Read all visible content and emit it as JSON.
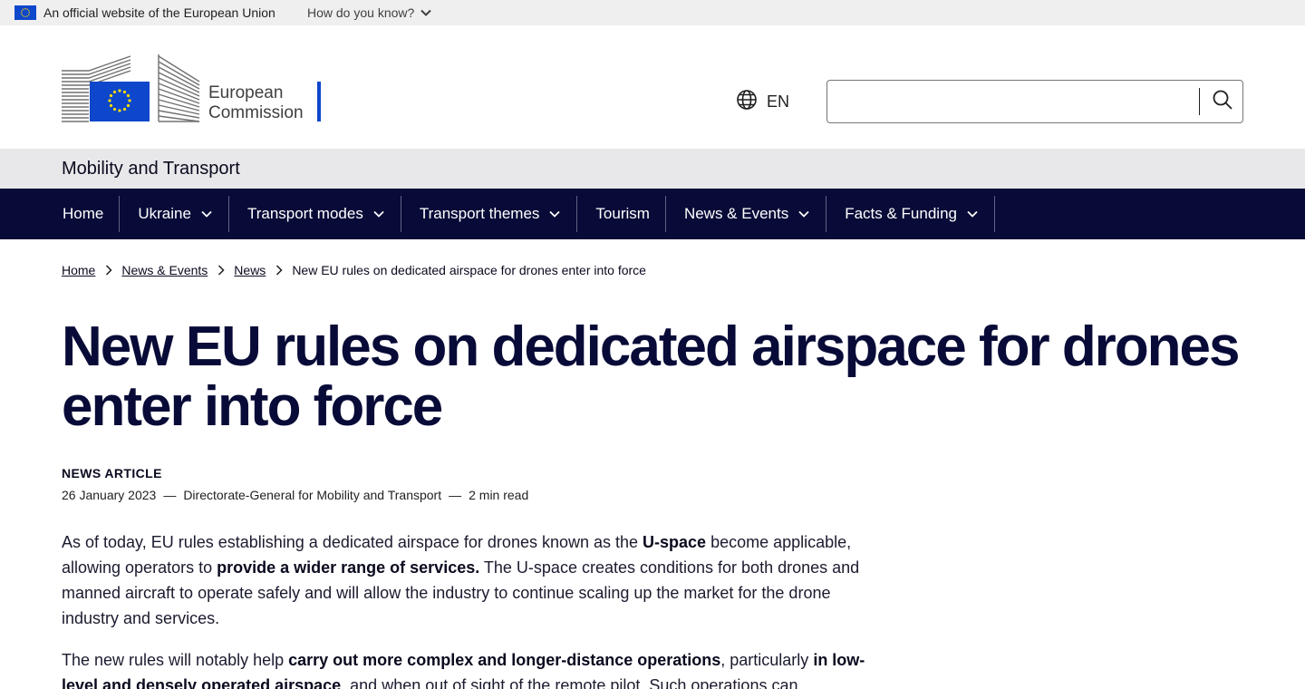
{
  "eu_bar": {
    "official_text": "An official website of the European Union",
    "how_do_you_know": "How do you know?",
    "flag_icon": "eu-flag-icon"
  },
  "header": {
    "logo_line1": "European",
    "logo_line2": "Commission",
    "language_code": "EN",
    "language_icon": "globe-icon",
    "search_placeholder": "",
    "search_icon": "search-icon"
  },
  "site_name": "Mobility and Transport",
  "nav": {
    "items": [
      {
        "label": "Home",
        "has_dropdown": false
      },
      {
        "label": "Ukraine",
        "has_dropdown": true
      },
      {
        "label": "Transport modes",
        "has_dropdown": true
      },
      {
        "label": "Transport themes",
        "has_dropdown": true
      },
      {
        "label": "Tourism",
        "has_dropdown": false
      },
      {
        "label": "News & Events",
        "has_dropdown": true
      },
      {
        "label": "Facts & Funding",
        "has_dropdown": true
      }
    ]
  },
  "breadcrumb": {
    "items": [
      "Home",
      "News & Events",
      "News"
    ],
    "current": "New EU rules on dedicated airspace for drones enter into force"
  },
  "article": {
    "title": "New EU rules on dedicated airspace for drones enter into force",
    "type": "NEWS ARTICLE",
    "date": "26 January 2023",
    "dash": "—",
    "author": "Directorate-General for Mobility and Transport",
    "read_time": "2 min read",
    "p1": {
      "a": "As of today, EU rules establishing a dedicated airspace for drones known as the ",
      "b": "U-space",
      "c": " become applicable, allowing operators to ",
      "d": "provide a wider range of services.",
      "e": " The U-space creates conditions for both drones and manned aircraft to operate safely and will allow the industry to continue scaling up the market for the drone industry and services."
    },
    "p2": {
      "a": "The new rules will notably help ",
      "b": "carry out more complex and longer-distance operations",
      "c": ", particularly ",
      "d": "in low-level and densely operated airspace",
      "e": ", and when out of sight of the remote pilot. Such operations can"
    }
  },
  "colors": {
    "nav_bg": "#080b37",
    "eu_blue": "#0e47cb",
    "eu_gold": "#ffdd00",
    "band_bg": "#e8e8ea",
    "top_bar_bg": "#efeff0"
  }
}
